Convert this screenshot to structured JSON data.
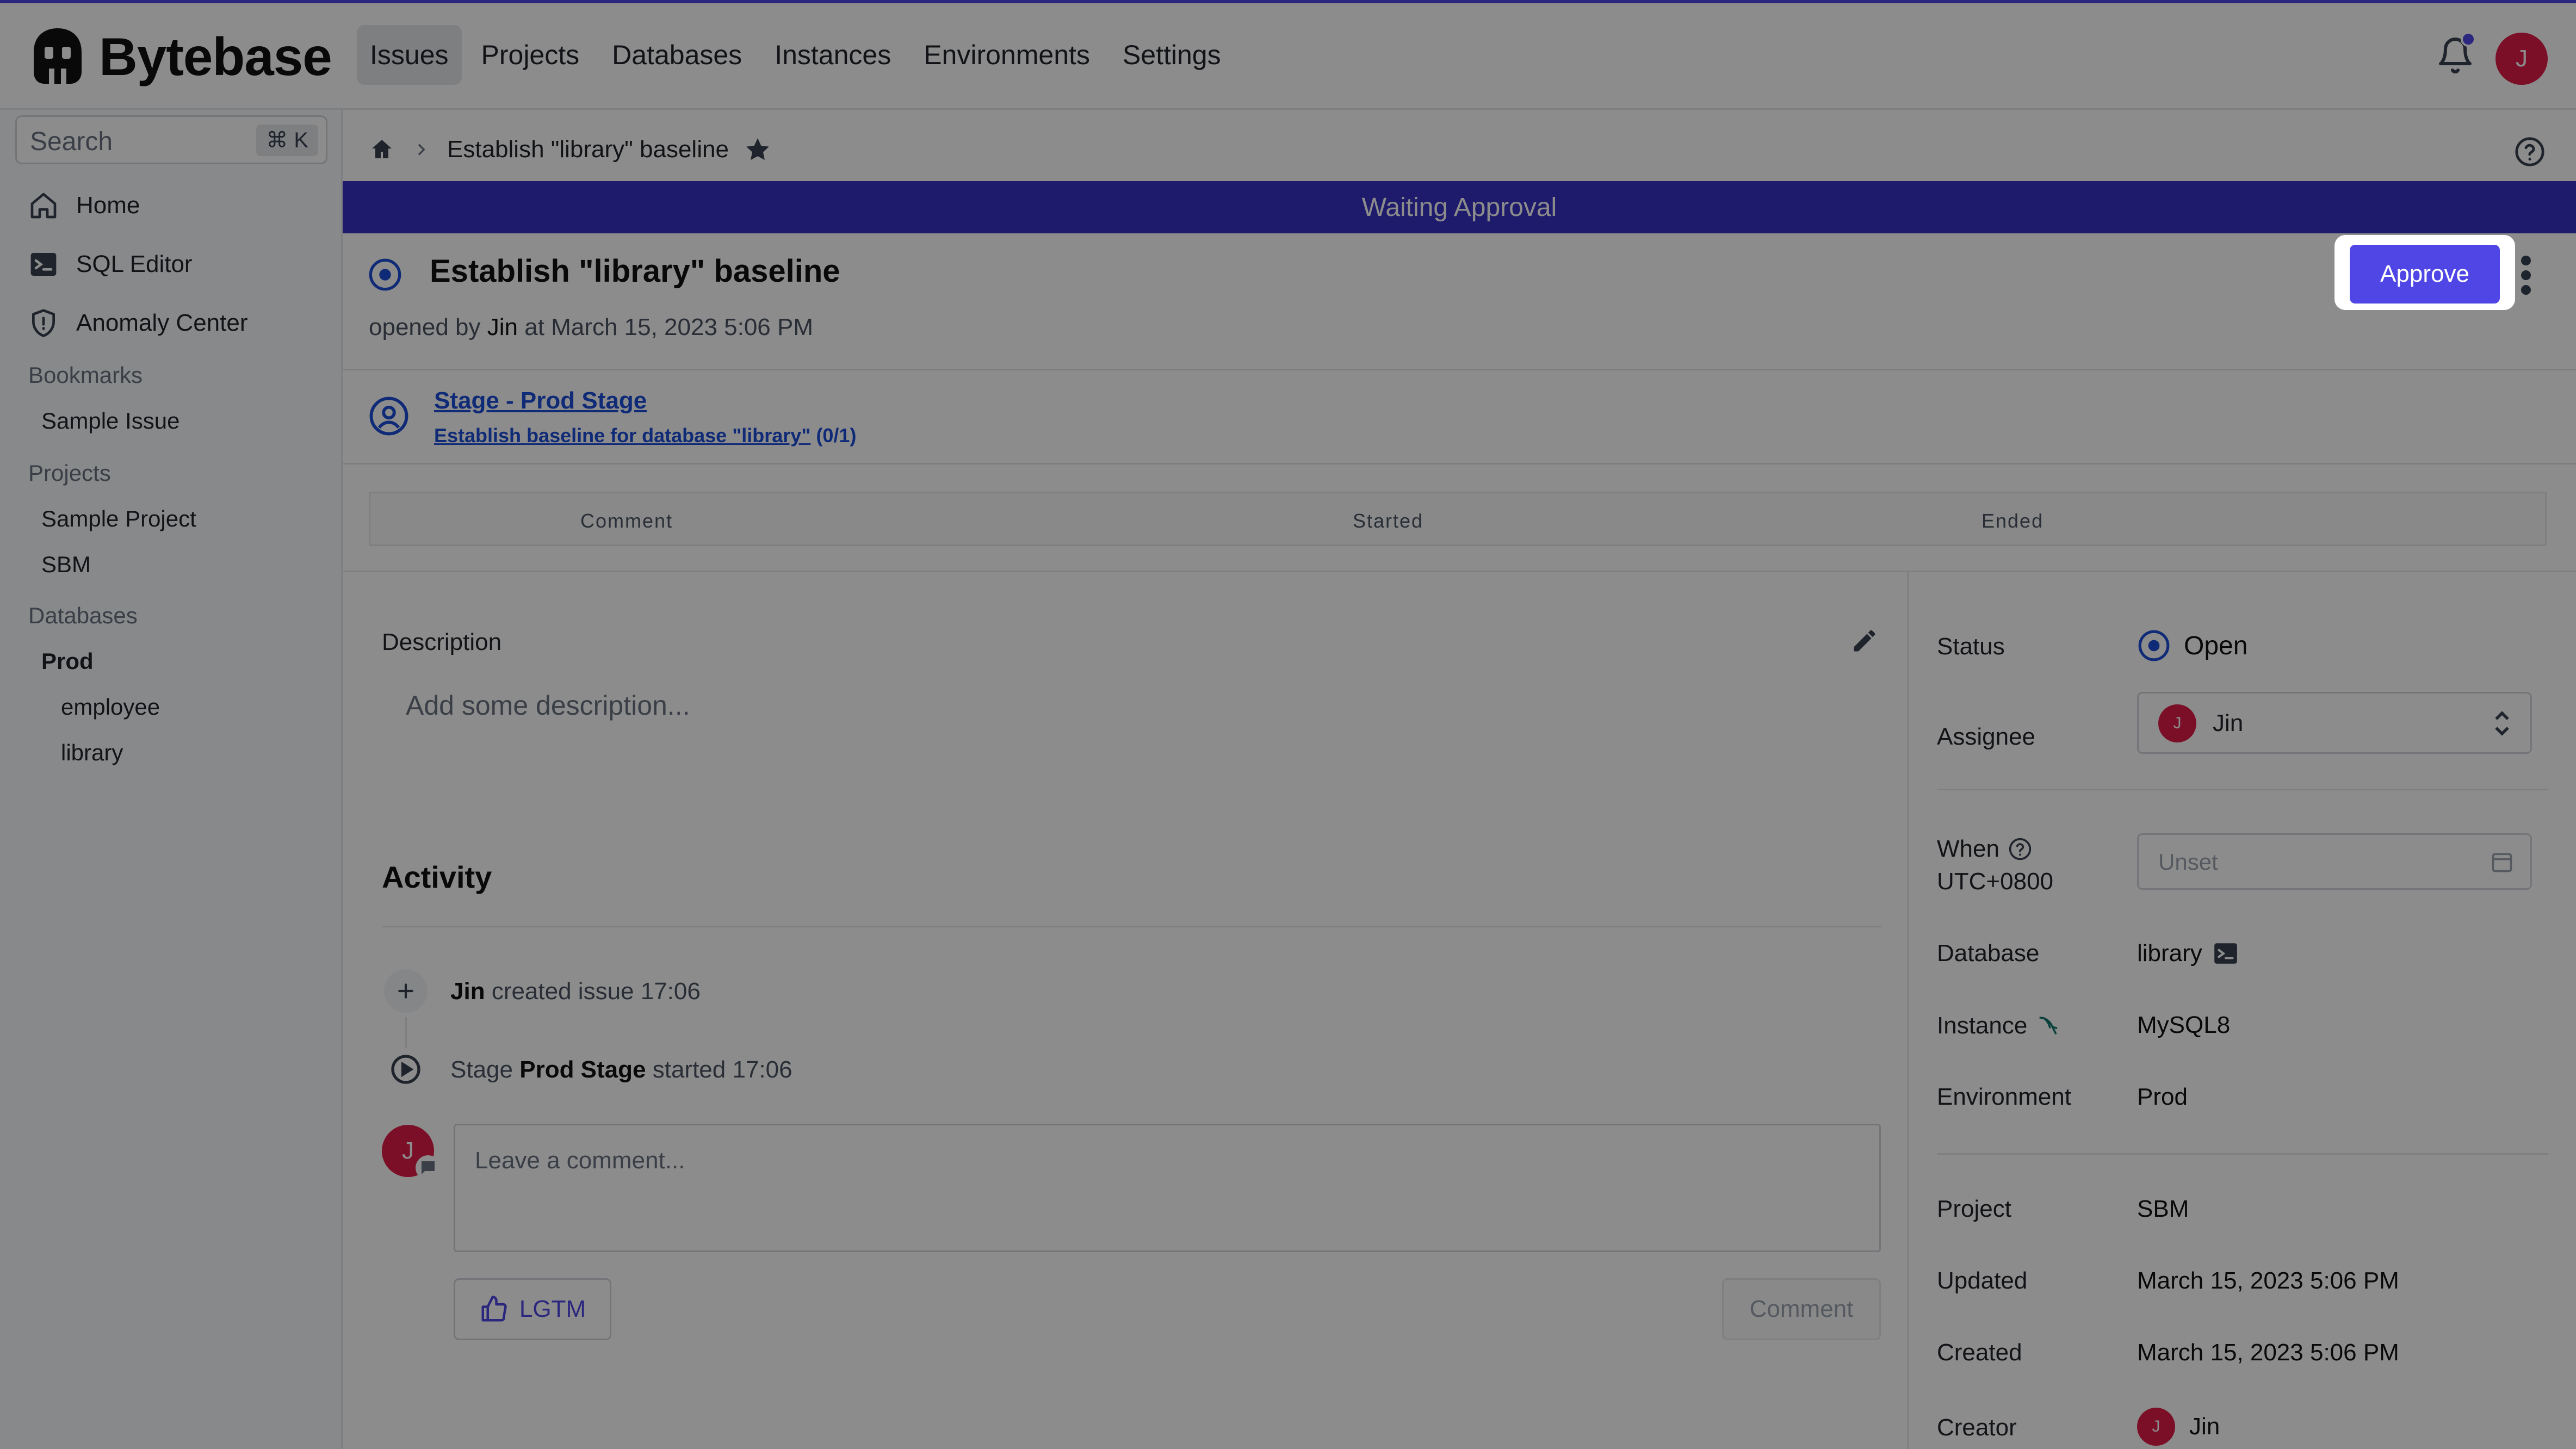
{
  "app": {
    "name": "Bytebase"
  },
  "nav": {
    "items": [
      {
        "label": "Issues"
      },
      {
        "label": "Projects"
      },
      {
        "label": "Databases"
      },
      {
        "label": "Instances"
      },
      {
        "label": "Environments"
      },
      {
        "label": "Settings"
      }
    ]
  },
  "user": {
    "initial": "J"
  },
  "search": {
    "placeholder": "Search",
    "shortcut": "⌘ K"
  },
  "sidebar": {
    "home": "Home",
    "sql_editor": "SQL Editor",
    "anomaly_center": "Anomaly Center",
    "bookmarks_head": "Bookmarks",
    "bookmarks": [
      "Sample Issue"
    ],
    "projects_head": "Projects",
    "projects": [
      "Sample Project",
      "SBM"
    ],
    "databases_head": "Databases",
    "db_env": "Prod",
    "databases": [
      "employee",
      "library"
    ]
  },
  "breadcrumb": {
    "current": "Establish \"library\" baseline"
  },
  "banner": {
    "text": "Waiting Approval"
  },
  "issue": {
    "title": "Establish \"library\" baseline",
    "opened_prefix": "opened by",
    "opened_by": "Jin",
    "opened_at": "at March 15, 2023 5:06 PM",
    "approve_label": "Approve"
  },
  "stage": {
    "name": "Stage - Prod Stage",
    "task": "Establish baseline for database \"library\"",
    "task_count": "(0/1)"
  },
  "task_table": {
    "headers": [
      "Comment",
      "Started",
      "Ended"
    ]
  },
  "description": {
    "label": "Description",
    "placeholder": "Add some description..."
  },
  "activity": {
    "title": "Activity",
    "items": [
      {
        "actor": "Jin",
        "text": "created issue 17:06"
      },
      {
        "prefix": "Stage",
        "stage": "Prod Stage",
        "text": "started 17:06"
      }
    ],
    "comment_placeholder": "Leave a comment...",
    "lgtm_label": "LGTM",
    "comment_label": "Comment"
  },
  "details": {
    "status_label": "Status",
    "status_value": "Open",
    "assignee_label": "Assignee",
    "assignee_value": "Jin",
    "when_label": "When",
    "when_tz": "UTC+0800",
    "when_placeholder": "Unset",
    "database_label": "Database",
    "database_value": "library",
    "instance_label": "Instance",
    "instance_value": "MySQL8",
    "environment_label": "Environment",
    "environment_value": "Prod",
    "project_label": "Project",
    "project_value": "SBM",
    "updated_label": "Updated",
    "updated_value": "March 15, 2023 5:06 PM",
    "created_label": "Created",
    "created_value": "March 15, 2023 5:06 PM",
    "creator_label": "Creator",
    "creator_value": "Jin"
  },
  "colors": {
    "accent": "#4f46e5",
    "banner": "#3730c5",
    "link": "#1d4ed8",
    "avatar": "#e11d48"
  }
}
